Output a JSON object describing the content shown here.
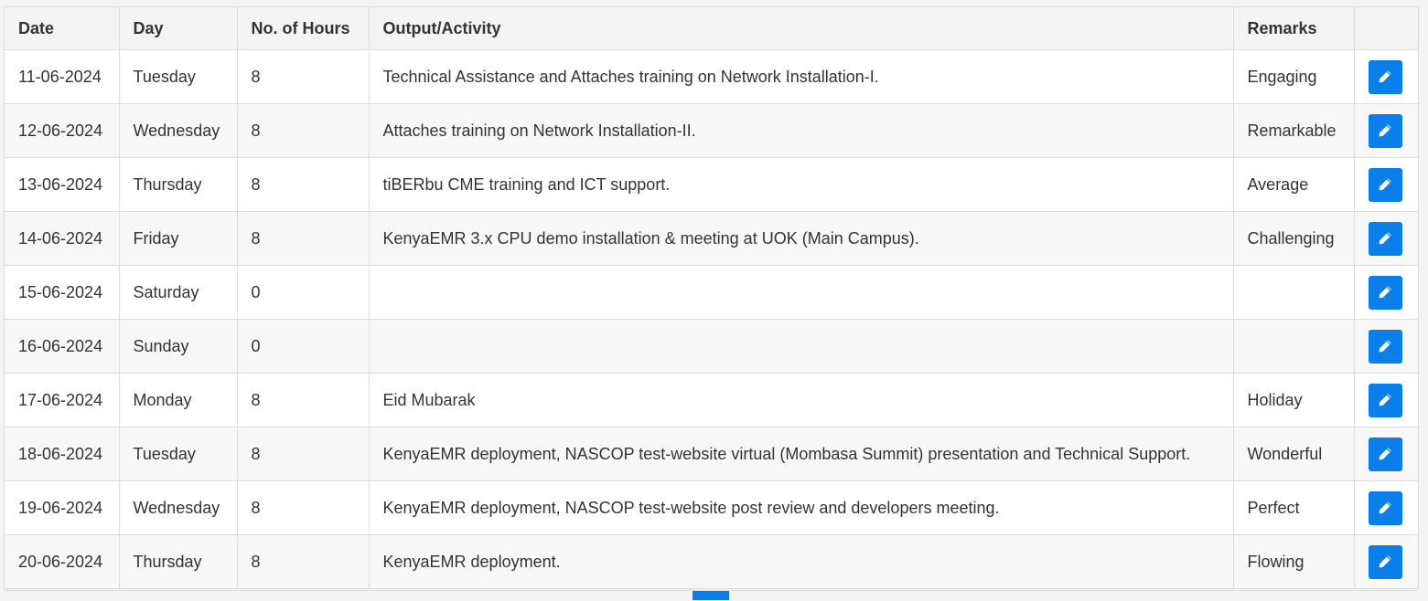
{
  "table": {
    "columns": [
      "Date",
      "Day",
      "No. of Hours",
      "Output/Activity",
      "Remarks",
      ""
    ],
    "rows": [
      {
        "date": "11-06-2024",
        "day": "Tuesday",
        "hours": "8",
        "activity": "Technical Assistance and Attaches training on Network Installation-I.",
        "remarks": "Engaging"
      },
      {
        "date": "12-06-2024",
        "day": "Wednesday",
        "hours": "8",
        "activity": "Attaches training on Network Installation-II.",
        "remarks": "Remarkable"
      },
      {
        "date": "13-06-2024",
        "day": "Thursday",
        "hours": "8",
        "activity": "tiBERbu CME training and ICT support.",
        "remarks": "Average"
      },
      {
        "date": "14-06-2024",
        "day": "Friday",
        "hours": "8",
        "activity": "KenyaEMR 3.x CPU demo installation & meeting at UOK (Main Campus).",
        "remarks": "Challenging"
      },
      {
        "date": "15-06-2024",
        "day": "Saturday",
        "hours": "0",
        "activity": "",
        "remarks": ""
      },
      {
        "date": "16-06-2024",
        "day": "Sunday",
        "hours": "0",
        "activity": "",
        "remarks": ""
      },
      {
        "date": "17-06-2024",
        "day": "Monday",
        "hours": "8",
        "activity": "Eid Mubarak",
        "remarks": "Holiday"
      },
      {
        "date": "18-06-2024",
        "day": "Tuesday",
        "hours": "8",
        "activity": "KenyaEMR deployment, NASCOP test-website virtual (Mombasa Summit) presentation and Technical Support.",
        "remarks": "Wonderful"
      },
      {
        "date": "19-06-2024",
        "day": "Wednesday",
        "hours": "8",
        "activity": "KenyaEMR deployment, NASCOP test-website post review and developers meeting.",
        "remarks": "Perfect"
      },
      {
        "date": "20-06-2024",
        "day": "Thursday",
        "hours": "8",
        "activity": "KenyaEMR deployment.",
        "remarks": "Flowing"
      }
    ],
    "edit_icon": "pencil-icon"
  },
  "colors": {
    "accent": "#0a7fe9",
    "header_bg": "#f4f4f4",
    "border": "#dcdcdc"
  }
}
